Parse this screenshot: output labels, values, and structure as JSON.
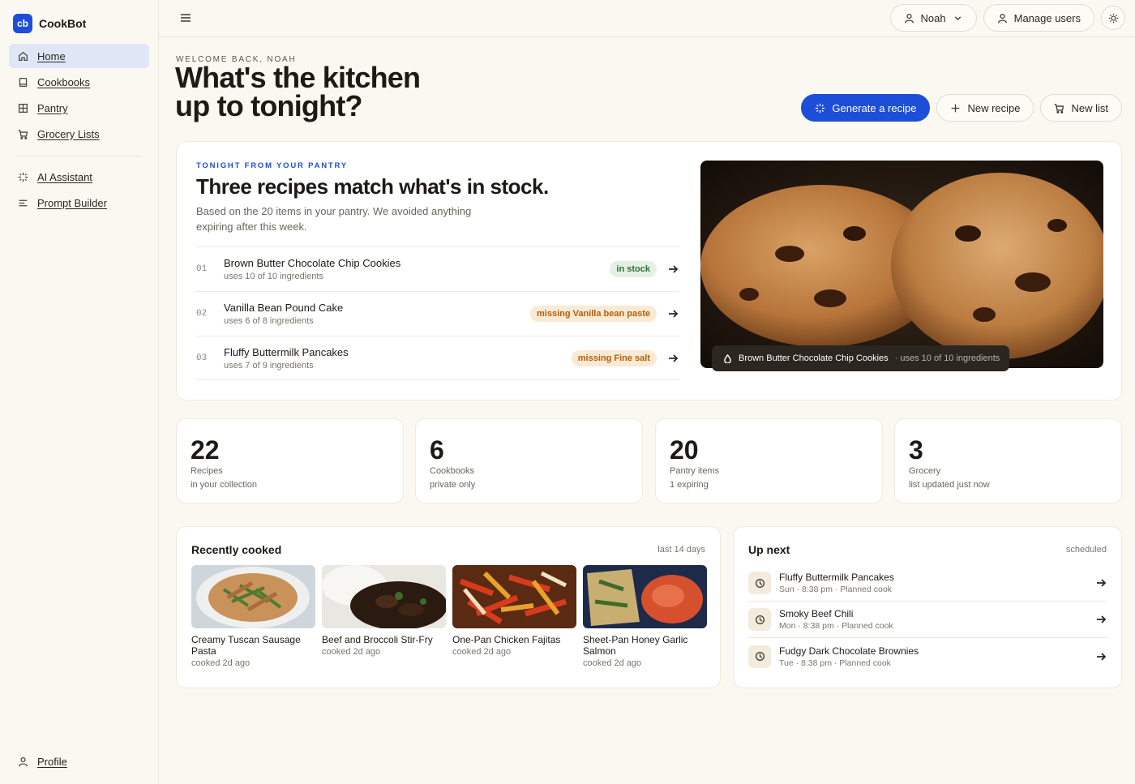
{
  "app": {
    "logo": "cb",
    "name": "CookBot"
  },
  "sidebar": {
    "items": [
      {
        "label": "Home",
        "icon": "home-icon",
        "active": true
      },
      {
        "label": "Cookbooks",
        "icon": "book-icon"
      },
      {
        "label": "Pantry",
        "icon": "grid-icon"
      },
      {
        "label": "Grocery Lists",
        "icon": "cart-icon"
      }
    ],
    "tools": [
      {
        "label": "AI Assistant",
        "icon": "sparkle-icon"
      },
      {
        "label": "Prompt Builder",
        "icon": "lines-icon"
      }
    ],
    "profile": "Profile"
  },
  "topbar": {
    "user": "Noah",
    "manage_users": "Manage users"
  },
  "header": {
    "eyebrow": "WELCOME BACK, NOAH",
    "title": "What's the kitchen up to tonight?",
    "actions": {
      "generate": "Generate a recipe",
      "new_recipe": "New recipe",
      "new_list": "New list"
    }
  },
  "tonight": {
    "eyebrow": "TONIGHT FROM YOUR PANTRY",
    "title": "Three recipes match what's in stock.",
    "description": "Based on the 20 items in your pantry. We avoided anything expiring after this week.",
    "recipes": [
      {
        "num": "01",
        "name": "Brown Butter Chocolate Chip Cookies",
        "sub": "uses 10 of 10 ingredients",
        "tag": "in stock",
        "tag_color": "#2f6e36"
      },
      {
        "num": "02",
        "name": "Vanilla Bean Pound Cake",
        "sub": "uses 6 of 8 ingredients",
        "tag": "missing Vanilla bean paste",
        "tag_color": "#b35e0c"
      },
      {
        "num": "03",
        "name": "Fluffy Buttermilk Pancakes",
        "sub": "uses 7 of 9 ingredients",
        "tag": "missing Fine salt",
        "tag_color": "#b35e0c"
      }
    ],
    "photo_caption": {
      "name": "Brown Butter Chocolate Chip Cookies",
      "meta": "· uses 10 of 10 ingredients"
    }
  },
  "stats": [
    {
      "num": "22",
      "label": "Recipes",
      "sub": "in your collection"
    },
    {
      "num": "6",
      "label": "Cookbooks",
      "sub": "private only"
    },
    {
      "num": "20",
      "label": "Pantry items",
      "sub": "1 expiring"
    },
    {
      "num": "3",
      "label": "Grocery",
      "sub": "list updated just now"
    }
  ],
  "recent": {
    "title": "Recently cooked",
    "meta": "last 14 days",
    "items": [
      {
        "name": "Creamy Tuscan Sausage Pasta",
        "ago": "cooked 2d ago"
      },
      {
        "name": "Beef and Broccoli Stir-Fry",
        "ago": "cooked 2d ago"
      },
      {
        "name": "One-Pan Chicken Fajitas",
        "ago": "cooked 2d ago"
      },
      {
        "name": "Sheet-Pan Honey Garlic Salmon",
        "ago": "cooked 2d ago"
      }
    ]
  },
  "upnext": {
    "title": "Up next",
    "meta": "scheduled",
    "items": [
      {
        "name": "Fluffy Buttermilk Pancakes",
        "sub": "Sun · 8:38 pm · Planned cook"
      },
      {
        "name": "Smoky Beef Chili",
        "sub": "Mon · 8:38 pm · Planned cook"
      },
      {
        "name": "Fudgy Dark Chocolate Brownies",
        "sub": "Tue · 8:38 pm · Planned cook"
      }
    ]
  },
  "colors": {
    "accent": "#1d4ed8",
    "background": "#fbf8f1",
    "card": "#ffffff"
  }
}
